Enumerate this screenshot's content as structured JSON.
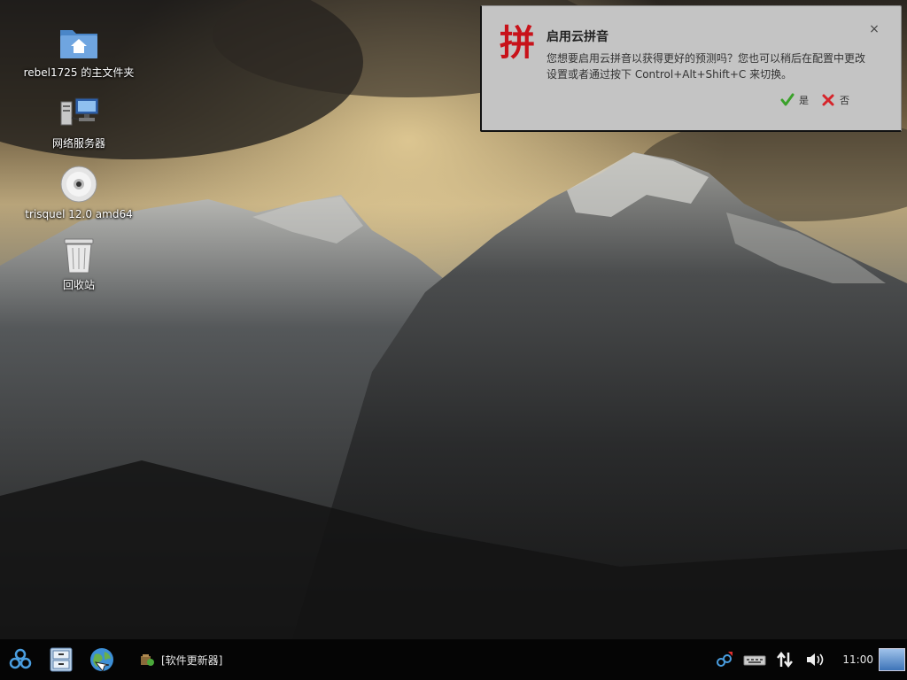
{
  "desktop": {
    "icons": [
      {
        "label": "rebel1725 的主文件夹",
        "icon": "home-folder-icon"
      },
      {
        "label": "网络服务器",
        "icon": "network-servers-icon"
      },
      {
        "label": "trisquel 12.0 amd64",
        "icon": "optical-disc-icon"
      },
      {
        "label": "回收站",
        "icon": "trash-icon"
      }
    ]
  },
  "notification": {
    "app_glyph": "拼",
    "title": "启用云拼音",
    "body": "您想要启用云拼音以获得更好的预测吗？您也可以稍后在配置中更改设置或者通过按下 Control+Alt+Shift+C 来切换。",
    "close": "×",
    "yes_label": "是",
    "no_label": "否",
    "accent": "#c8121a"
  },
  "taskbar": {
    "task_label": "[软件更新器]",
    "clock": "11:00"
  }
}
